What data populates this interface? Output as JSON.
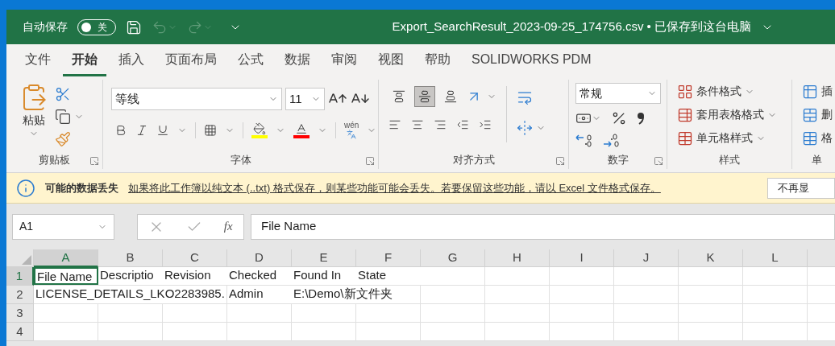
{
  "title_bar": {
    "autosave_label": "自动保存",
    "autosave": {
      "on": false,
      "label": "关"
    },
    "undo_disabled": true,
    "title": "Export_SearchResult_2023-09-25_174756.csv • 已保存到这台电脑"
  },
  "tabs": [
    {
      "label": "文件",
      "selected": false
    },
    {
      "label": "开始",
      "selected": true
    },
    {
      "label": "插入",
      "selected": false
    },
    {
      "label": "页面布局",
      "selected": false
    },
    {
      "label": "公式",
      "selected": false
    },
    {
      "label": "数据",
      "selected": false
    },
    {
      "label": "审阅",
      "selected": false
    },
    {
      "label": "视图",
      "selected": false
    },
    {
      "label": "帮助",
      "selected": false
    },
    {
      "label": "SOLIDWORKS PDM",
      "selected": false
    }
  ],
  "ribbon": {
    "clipboard": {
      "paste_label": "粘贴",
      "group_label": "剪贴板"
    },
    "font": {
      "font_name": "等线",
      "font_size": "11",
      "phonetic_label": "wén",
      "group_label": "字体"
    },
    "alignment": {
      "vertical": [
        {
          "selected": false
        },
        {
          "selected": true
        },
        {
          "selected": false
        }
      ],
      "group_label": "对齐方式"
    },
    "number": {
      "format": "常规",
      "group_label": "数字"
    },
    "styles": {
      "items": [
        "条件格式",
        "套用表格格式",
        "单元格样式"
      ],
      "group_label": "样式"
    },
    "cells": {
      "items": [
        "插",
        "删",
        "格"
      ],
      "group_label": "单"
    }
  },
  "message_bar": {
    "title": "可能的数据丢失",
    "message": "如果将此工作簿以纯文本 (..txt) 格式保存，则某些功能可能会丢失。若要保留这些功能，请以 Excel 文件格式保存。",
    "button": "不再显"
  },
  "formula_bar": {
    "name_box": "A1",
    "function_label": "fx",
    "value": "File Name"
  },
  "grid": {
    "columns": [
      {
        "label": "A",
        "selected": true
      },
      {
        "label": "B",
        "selected": false
      },
      {
        "label": "C",
        "selected": false
      },
      {
        "label": "D",
        "selected": false
      },
      {
        "label": "E",
        "selected": false
      },
      {
        "label": "F",
        "selected": false
      },
      {
        "label": "G",
        "selected": false
      },
      {
        "label": "H",
        "selected": false
      },
      {
        "label": "I",
        "selected": false
      },
      {
        "label": "J",
        "selected": false
      },
      {
        "label": "K",
        "selected": false
      },
      {
        "label": "L",
        "selected": false
      }
    ],
    "rows": [
      {
        "label": "1",
        "selected": true,
        "cells": [
          "File Name",
          "Descriptio",
          "Revision",
          "Checked",
          "Found In",
          "State"
        ]
      },
      {
        "label": "2",
        "selected": false,
        "cells": [
          "LICENSE_DETAILS_LKO2283985.",
          "",
          "",
          "Admin",
          "E:\\Demo\\新文件夹"
        ]
      },
      {
        "label": "3",
        "selected": false
      },
      {
        "label": "4",
        "selected": false
      }
    ]
  }
}
